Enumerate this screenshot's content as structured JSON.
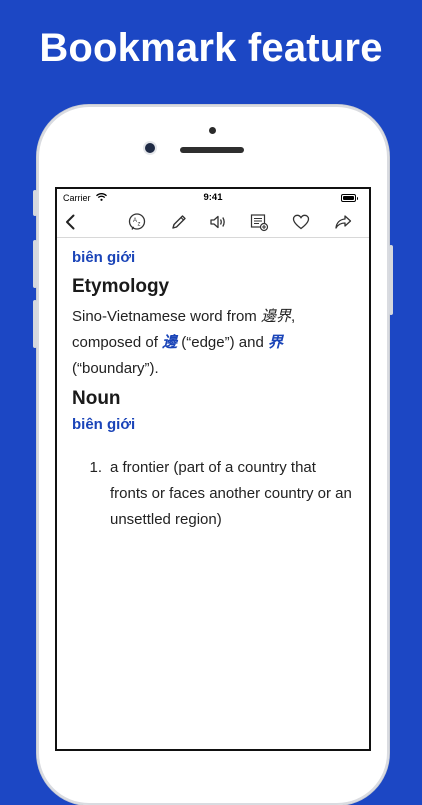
{
  "promo": {
    "title": "Bookmark feature"
  },
  "statusbar": {
    "carrier": "Carrier",
    "time": "9:41"
  },
  "toolbar": {
    "icons": [
      "chevron-left-icon",
      "translate-icon",
      "pencil-icon",
      "speaker-icon",
      "add-list-icon",
      "heart-icon",
      "share-icon"
    ]
  },
  "entry": {
    "headword": "biên giới",
    "etymology": {
      "heading": "Etymology",
      "text_1": "Sino-Vietnamese word from ",
      "cjk_1": "邊界",
      "text_2": ",",
      "text_3": "composed of ",
      "link_1": "邊",
      "text_4": " (“edge”) and ",
      "link_2": "界",
      "text_5": "(“boundary”)."
    },
    "noun": {
      "heading": "Noun",
      "headword": "biên giới",
      "definitions": [
        {
          "number": "1.",
          "text": "a frontier (part of a country that fronts or faces another country or an unsettled region)"
        }
      ]
    }
  },
  "colors": {
    "background": "#1c47c4",
    "link": "#1a44b8"
  }
}
